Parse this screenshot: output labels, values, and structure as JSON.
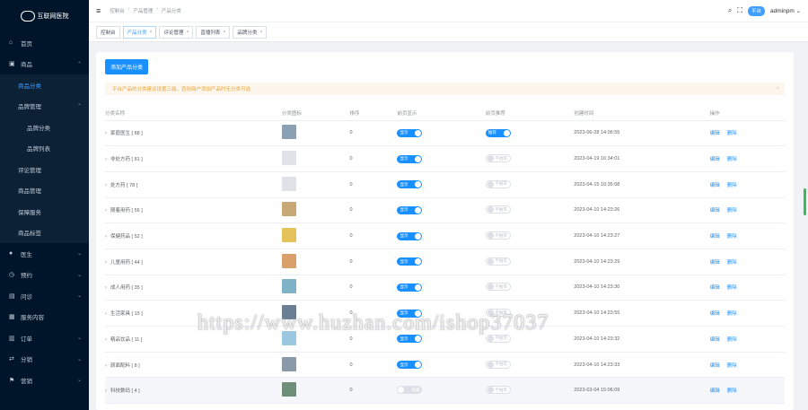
{
  "brand": {
    "name": "互联网医院"
  },
  "sidebar": {
    "items": [
      {
        "label": "首页",
        "icon": "home-icon"
      },
      {
        "label": "商品",
        "icon": "shop-icon"
      },
      {
        "label": "商品分类"
      },
      {
        "label": "品牌管理"
      },
      {
        "label": "品牌分类"
      },
      {
        "label": "品牌列表"
      },
      {
        "label": "评论管理"
      },
      {
        "label": "商品管理"
      },
      {
        "label": "保障服务"
      },
      {
        "label": "商品标签"
      },
      {
        "label": "医生",
        "icon": "user-icon"
      },
      {
        "label": "预约",
        "icon": "calendar-icon"
      },
      {
        "label": "问诊",
        "icon": "chat-icon"
      },
      {
        "label": "服务内容",
        "icon": "service-icon"
      },
      {
        "label": "订单",
        "icon": "order-icon"
      },
      {
        "label": "分销",
        "icon": "share-icon"
      },
      {
        "label": "营销",
        "icon": "flag-icon"
      }
    ]
  },
  "header": {
    "breadcrumb": [
      "控制台",
      "产品管理",
      "产品分类"
    ],
    "badge": "平台",
    "user": "adminpm"
  },
  "tabs": [
    {
      "label": "控制台"
    },
    {
      "label": "产品分类"
    },
    {
      "label": "评论管理"
    },
    {
      "label": "直播列表"
    },
    {
      "label": "品牌分类"
    }
  ],
  "toolbar": {
    "add_label": "添加产品分类"
  },
  "alert": {
    "text": "平台产品的分类建议设置三级，否则商户添加产品时无分类可选"
  },
  "table": {
    "headers": [
      "分类名称",
      "分类图标",
      "排序",
      "前页显示",
      "前页推荐",
      "创建时间",
      "操作"
    ],
    "edit_label": "编辑",
    "delete_label": "删除",
    "rows": [
      {
        "name": "家庭医生 [ 88 ]",
        "sort": "0",
        "show": "显示",
        "rec": "推荐",
        "created": "2023-06-28 14:06:55"
      },
      {
        "name": "非处方药 [ 81 ]",
        "sort": "0",
        "show": "显示",
        "rec": "不推荐",
        "created": "2023-04-19 16:34:01"
      },
      {
        "name": "处方药 [ 78 ]",
        "sort": "0",
        "show": "显示",
        "rec": "不推荐",
        "created": "2023-04-15 10:35:08"
      },
      {
        "name": "随着用药 [ 56 ]",
        "sort": "0",
        "show": "显示",
        "rec": "不推荐",
        "created": "2023-04-10 14:23:26"
      },
      {
        "name": "保健药品 [ 52 ]",
        "sort": "0",
        "show": "显示",
        "rec": "不推荐",
        "created": "2023-04-10 14:23:27"
      },
      {
        "name": "儿童用药 [ 44 ]",
        "sort": "0",
        "show": "显示",
        "rec": "不推荐",
        "created": "2023-04-10 14:23:29"
      },
      {
        "name": "成人用药 [ 35 ]",
        "sort": "0",
        "show": "显示",
        "rec": "不推荐",
        "created": "2023-04-10 14:23:30"
      },
      {
        "name": "生活家具 [ 15 ]",
        "sort": "0",
        "show": "显示",
        "rec": "不推荐",
        "created": "2023-04-10 14:23:55"
      },
      {
        "name": "精品饮品 [ 11 ]",
        "sort": "0",
        "show": "显示",
        "rec": "不推荐",
        "created": "2023-04-10 14:23:32"
      },
      {
        "name": "颜面配料 [ 8 ]",
        "sort": "0",
        "show": "显示",
        "rec": "不推荐",
        "created": "2023-04-10 14:23:33"
      },
      {
        "name": "科技数码 [ 4 ]",
        "sort": "0",
        "show": "隐藏",
        "rec": "不推荐",
        "created": "2023-03-04 15:06:09"
      }
    ]
  },
  "watermark": "https://www.huzhan.com/ishop37037",
  "colors": {
    "primary": "#1890ff",
    "sidebar": "#001529",
    "warning": "#e6a23c"
  }
}
